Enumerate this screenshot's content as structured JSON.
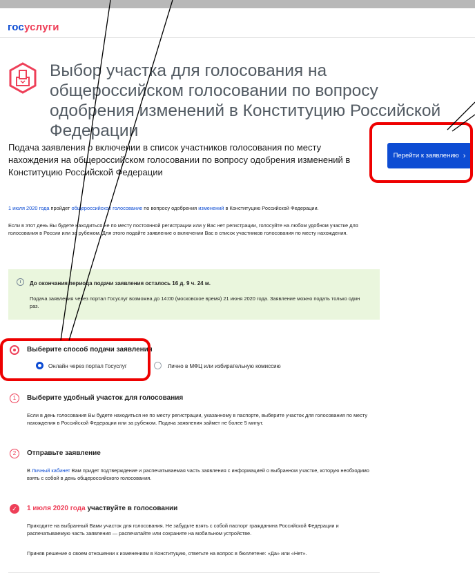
{
  "header": {
    "logo_part1": "гос",
    "logo_part2": "услуги"
  },
  "page": {
    "title": "Выбор участка для голосования на общероссийском голосовании по вопросу одобрения изменений в Конституцию Российской Федерации",
    "subtitle": "Подача заявления о включении в список участников голосования по месту нахождения на общероссийском голосовании по вопросу одобрения изменений в Конституцию Российской Федерации",
    "go_button": "Перейти к заявлению"
  },
  "intro": {
    "date": "1 июля 2020 года",
    "text1": " пройдет ",
    "link1": "общероссийское голосование",
    "text2": " по вопросу одобрения ",
    "link2": "изменений",
    "text3": " в Конституцию Российской Федерации.",
    "para2": "Если в этот день Вы будете находиться не по месту постоянной регистрации или у Вас нет регистрации, голосуйте на любом удобном участке для голосования в России или за рубежом. Для этого подайте заявление о включении Вас в список участников голосования по месту нахождения."
  },
  "notice": {
    "title": "До окончания периода подачи заявления осталось 16 д. 9 ч. 24 м.",
    "text": "Подача заявления через портал Госуслуг возможна до 14:00 (московское время) 21 июня 2020 года. Заявление можно подать только один раз."
  },
  "steps": {
    "s1": {
      "title": "Выберите способ подачи заявления",
      "option_online": "Онлайн через портал Госуслуг",
      "option_offline": "Лично в МФЦ или избирательную комиссию"
    },
    "s2": {
      "num": "1",
      "title": "Выберите удобный участок для голосования",
      "text": "Если в день голосования Вы будете находиться не по месту регистрации, указанному в паспорте, выберите участок для голосования по месту нахождения в Российской Федерации или за рубежом. Подача заявления займет не более 5 минут."
    },
    "s3": {
      "num": "2",
      "title": "Отправьте заявление",
      "text_pre": "В ",
      "link": "Личный кабинет",
      "text_post": " Вам придет подтверждение и распечатываемая часть заявления с информацией о выбранном участке, которую необходимо взять с собой в день общероссийского голосования."
    },
    "s4": {
      "check": "✓",
      "title_date": "1 июля 2020 года",
      "title_rest": " участвуйте в голосовании",
      "text1": "Приходите на выбранный Вами участок для голосования. Не забудьте взять с собой паспорт гражданина Российской Федерации и распечатываемую часть заявления — распечатайте или сохраните на мобильном устройстве.",
      "text2": "Приняв решение о своем отношении к изменениям в Конституцию, ответьте на вопрос в бюллетене: «Да» или «Нет»."
    }
  },
  "colors": {
    "brand_blue": "#0d4cd3",
    "brand_red": "#ee3f58",
    "notice_bg": "#eaf6dd",
    "annotation_red": "#ee0000"
  }
}
